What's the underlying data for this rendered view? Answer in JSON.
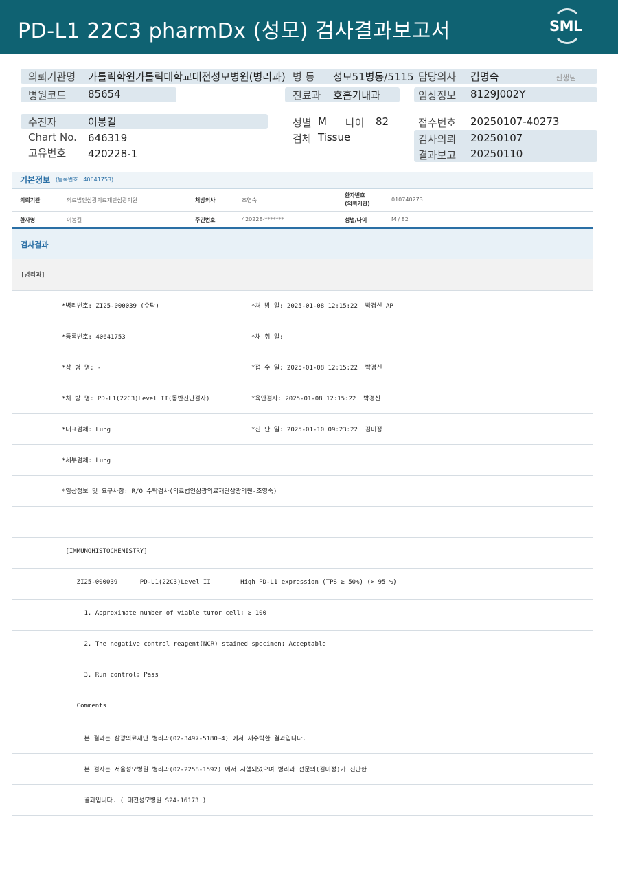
{
  "header": {
    "title": "PD-L1 22C3 pharmDx (성모) 검사결과보고서",
    "logo_text": "SML"
  },
  "top_info": {
    "institution_label": "의뢰기관명",
    "institution_value": "가톨릭학원가톨릭대학교대전성모병원(병리과)",
    "ward_label": "병 동",
    "ward_value": "성모51병동/5115",
    "doctor_label": "담당의사",
    "doctor_value": "김명숙",
    "doctor_suffix": "선생님",
    "hospital_code_label": "병원코드",
    "hospital_code_value": "85654",
    "dept_label": "진료과",
    "dept_value": "호흡기내과",
    "clinical_label": "임상정보",
    "clinical_value": "8129J002Y",
    "patient_label": "수진자",
    "patient_value": "이봉길",
    "sex_label": "성별",
    "sex_value": "M",
    "age_label": "나이",
    "age_value": "82",
    "receipt_label": "접수번호",
    "receipt_value": "20250107-40273",
    "chart_label": "Chart No.",
    "chart_value": "646319",
    "specimen_label": "검체",
    "specimen_value": "Tissue",
    "request_label": "검사의뢰",
    "request_value": "20250107",
    "uid_label": "고유번호",
    "uid_value": "420228-1",
    "report_label": "결과보고",
    "report_value": "20250110"
  },
  "basic": {
    "title": "기본정보",
    "sub": "(등록번호 : 40641753)",
    "row1": {
      "k1": "의뢰기관",
      "v1": "의료법인삼광의료재단삼광의원",
      "k2": "처방의사",
      "v2": "조영숙",
      "k3a": "환자번호",
      "k3b": "(의뢰기관)",
      "v3": "010740273"
    },
    "row2": {
      "k1": "환자명",
      "v1": "이봉길",
      "k2": "주민번호",
      "v2": "420228-*******",
      "k3": "성별/나이",
      "v3": "M / 82"
    }
  },
  "result": {
    "title": "검사결과",
    "section": "[병리과]",
    "lines": [
      {
        "left": "*병리번호: ZI25-000039 (수탁)",
        "right": "*처 방 일: 2025-01-08 12:15:22  박경신 AP"
      },
      {
        "left": "*등록번호: 40641753",
        "right": "*채 취 일:"
      },
      {
        "left": "*상 병 명: -",
        "right": "*접 수 일: 2025-01-08 12:15:22  박경신"
      },
      {
        "left": "*처 방 명: PD-L1(22C3)Level II(동반진단검사)",
        "right": "*육안검사: 2025-01-08 12:15:22  박경신"
      },
      {
        "left": "*대표검체: Lung",
        "right": "*진 단 일: 2025-01-10 09:23:22  김미정"
      },
      {
        "left": "*세부검체: Lung",
        "right": ""
      },
      {
        "left": "*임상정보 및 요구사항: R/O 수탁검사(의료법인삼광의료재단삼광의원-조영숙)",
        "right": ""
      },
      {
        "left": "",
        "right": ""
      },
      {
        "left": " [IMMUNOHISTOCHEMISTRY]",
        "right": ""
      },
      {
        "left": "    ZI25-000039      PD-L1(22C3)Level II        High PD-L1 expression (TPS ≥ 50%) (> 95 %)",
        "right": ""
      },
      {
        "left": "      1. Approximate number of viable tumor cell; ≥ 100",
        "right": ""
      },
      {
        "left": "      2. The negative control reagent(NCR) stained specimen; Acceptable",
        "right": ""
      },
      {
        "left": "      3. Run control; Pass",
        "right": ""
      },
      {
        "left": "    Comments",
        "right": ""
      },
      {
        "left": "      본 결과는 삼광의료재단 병리과(02-3497-5180~4) 에서 재수탁한 결과입니다.",
        "right": ""
      },
      {
        "left": "      본 검사는 서울성모병원 병리과(02-2258-1592) 에서 시행되었으며 병리과 전문의(김미정)가 진단한",
        "right": ""
      },
      {
        "left": "      결과입니다. ( 대전성모병원 S24-16173 )",
        "right": ""
      }
    ]
  }
}
